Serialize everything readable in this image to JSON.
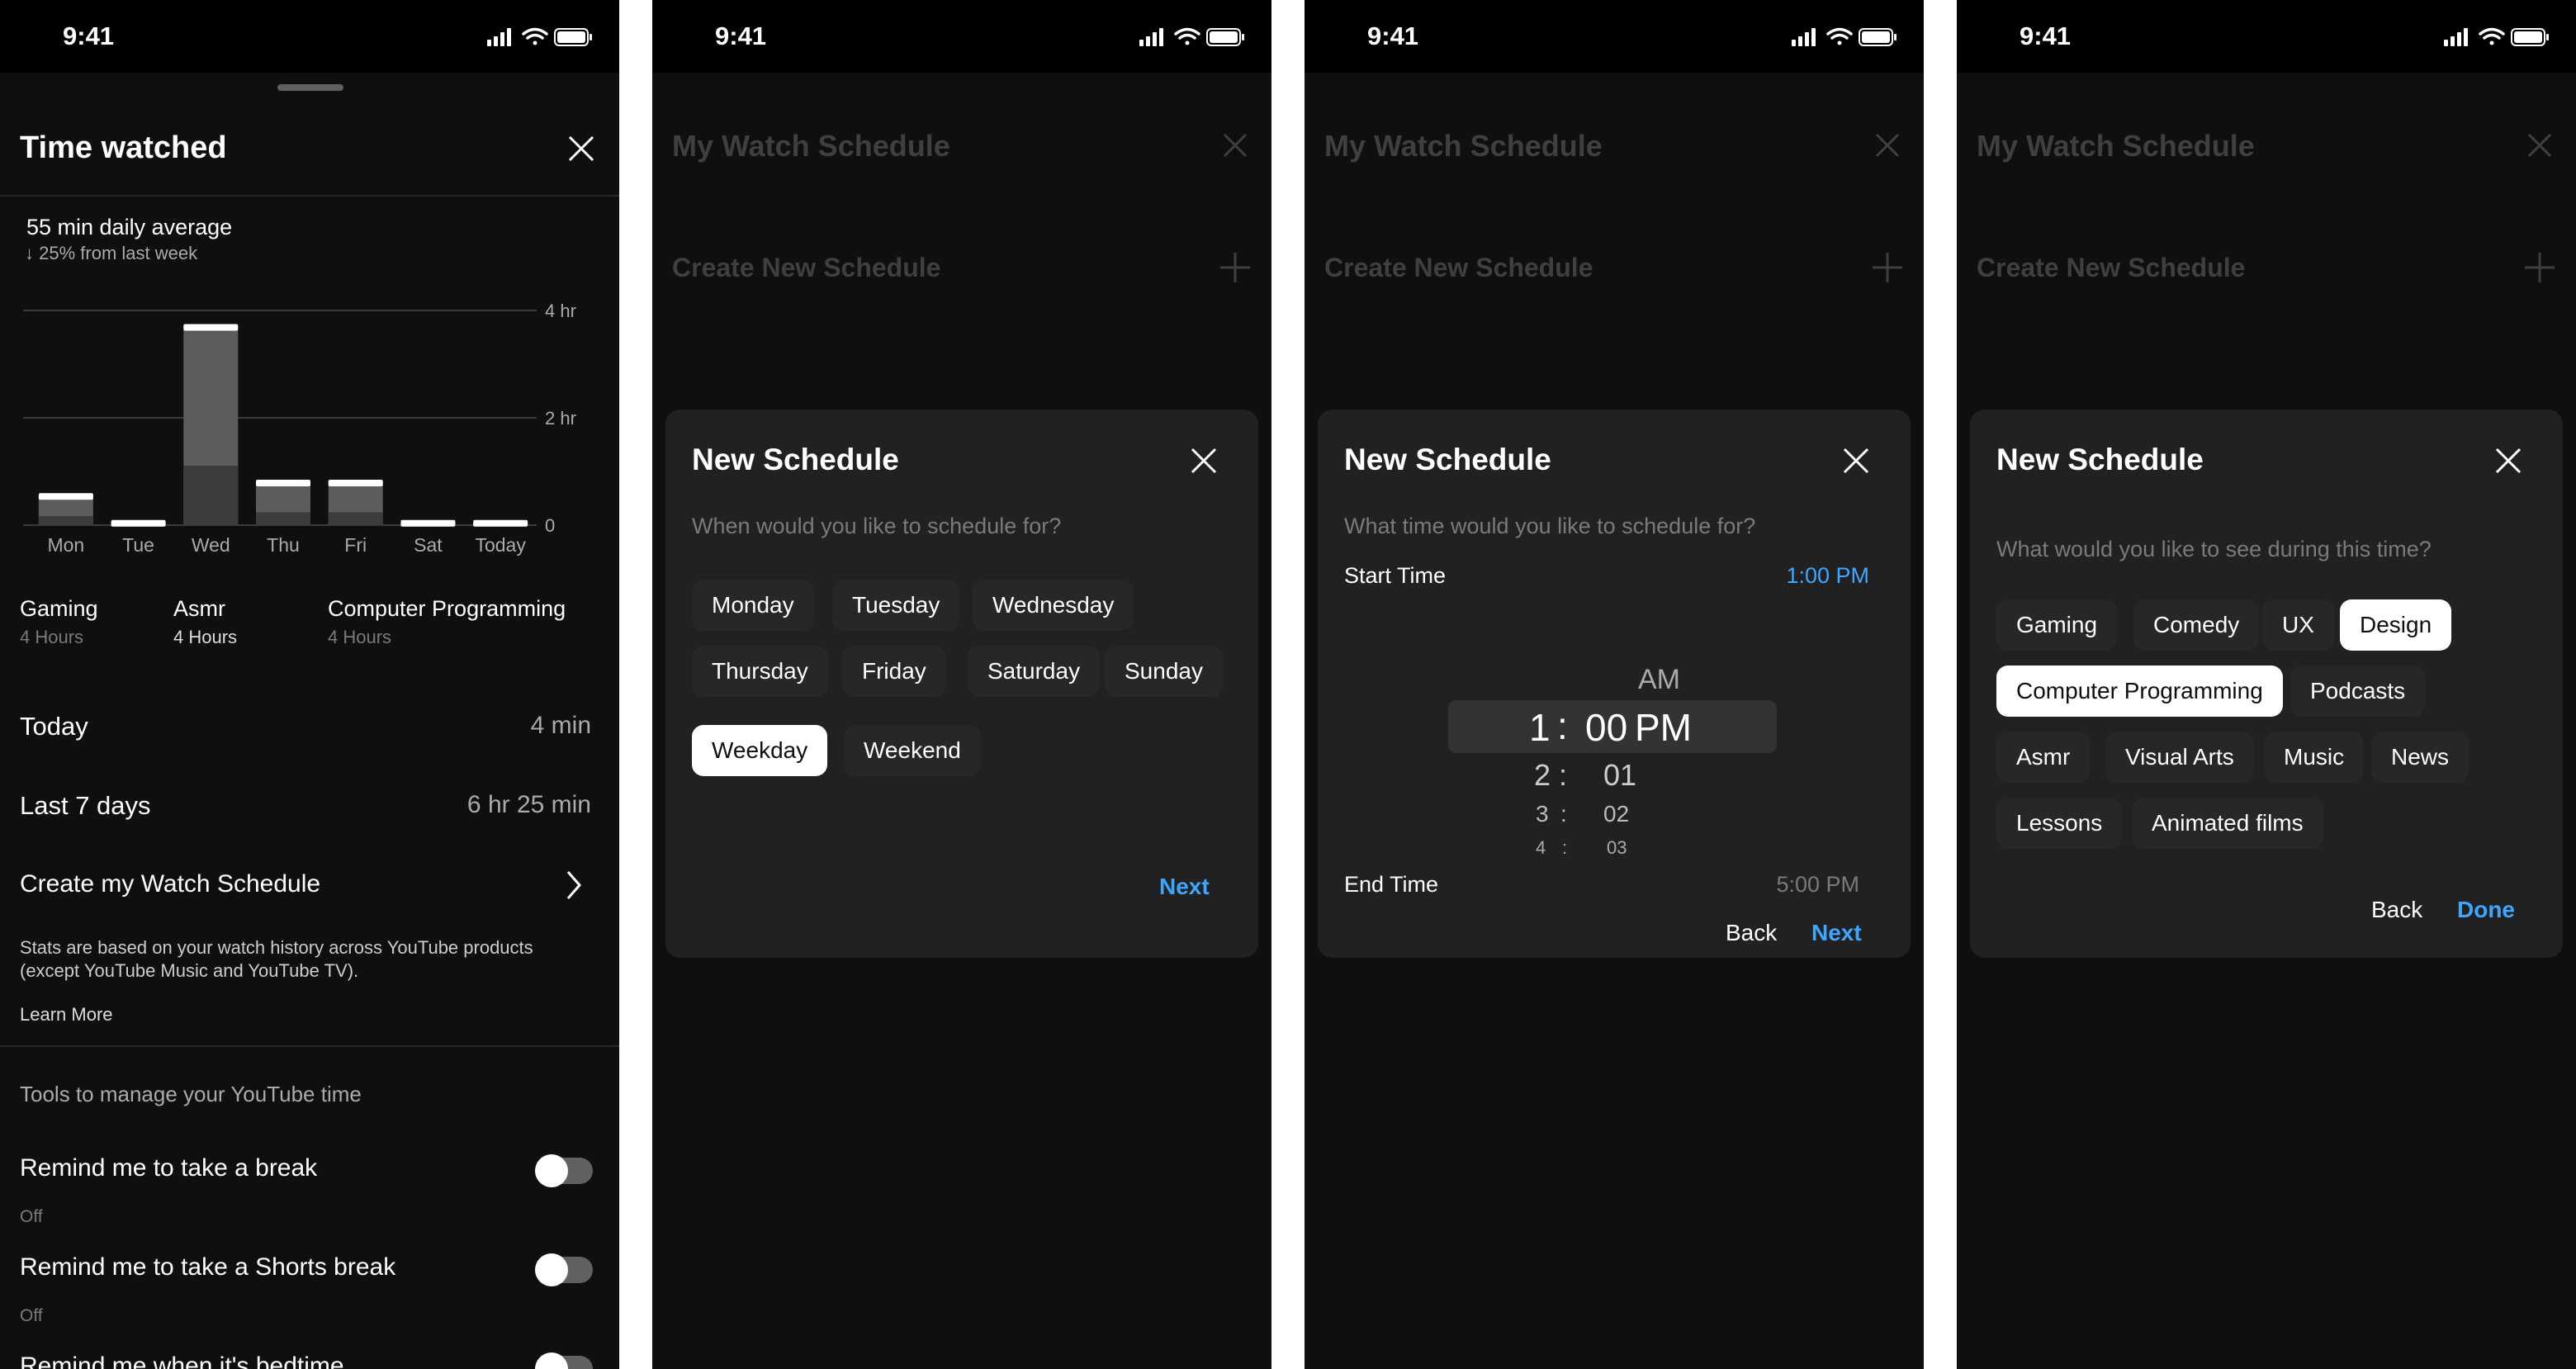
{
  "status": {
    "time": "9:41"
  },
  "p1": {
    "title": "Time watched",
    "average": "55 min daily average",
    "change": "25% from last week",
    "chart_data": {
      "type": "bar",
      "categories": [
        "Mon",
        "Tue",
        "Wed",
        "Thu",
        "Fri",
        "Sat",
        "Today"
      ],
      "values": [
        0.55,
        0.05,
        3.7,
        0.8,
        0.8,
        0.05,
        0.05
      ],
      "ylim": [
        0,
        4
      ],
      "yticks": [
        "4 hr",
        "2 hr",
        "0"
      ],
      "grid": true
    },
    "categories": [
      {
        "name": "Gaming",
        "hours": "4 Hours"
      },
      {
        "name": "Asmr",
        "hours": "4 Hours"
      },
      {
        "name": "Computer Programming",
        "hours": "4 Hours"
      }
    ],
    "today_label": "Today",
    "today_value": "4 min",
    "week_label": "Last 7 days",
    "week_value": "6 hr 25 min",
    "create_label": "Create my Watch Schedule",
    "stats_note": "Stats are based on your watch history across YouTube products (except YouTube Music and YouTube TV).",
    "learn_more": "Learn More",
    "tools_heading": "Tools to manage your YouTube time",
    "toggles": [
      {
        "label": "Remind me to take a break",
        "state": "Off"
      },
      {
        "label": "Remind me to take a Shorts break",
        "state": "Off"
      },
      {
        "label": "Remind me when it's bedtime",
        "state": ""
      }
    ]
  },
  "bg": {
    "title": "My Watch Schedule",
    "create": "Create New Schedule"
  },
  "modal": {
    "title": "New Schedule",
    "next": "Next",
    "back": "Back",
    "done": "Done"
  },
  "p2": {
    "question": "When would you like to schedule for?",
    "days": [
      "Monday",
      "Tuesday",
      "Wednesday",
      "Thursday",
      "Friday",
      "Saturday",
      "Sunday",
      "Weekday",
      "Weekend"
    ],
    "selected": "Weekday"
  },
  "p3": {
    "question": "What time would you like to schedule for?",
    "start_label": "Start Time",
    "start_value": "1:00 PM",
    "end_label": "End Time",
    "end_value": "5:00 PM",
    "picker": {
      "am": "AM",
      "sel_hour": "1",
      "sel_min": "00",
      "sel_period": "PM",
      "rows": [
        {
          "hour": "2",
          "min": "01"
        },
        {
          "hour": "3",
          "min": "02"
        },
        {
          "hour": "4",
          "min": "03"
        }
      ],
      "colon": ":"
    }
  },
  "p4": {
    "question": "What would you like to see during this time?",
    "topics": [
      "Gaming",
      "Comedy",
      "UX",
      "Design",
      "Computer Programming",
      "Podcasts",
      "Asmr",
      "Visual Arts",
      "Music",
      "News",
      "Lessons",
      "Animated films"
    ],
    "selected": [
      "Design",
      "Computer Programming"
    ]
  },
  "colors": {
    "bg": "#0f0f0f",
    "card": "#212121",
    "chip": "#272727",
    "accent": "#3ea6ff"
  }
}
